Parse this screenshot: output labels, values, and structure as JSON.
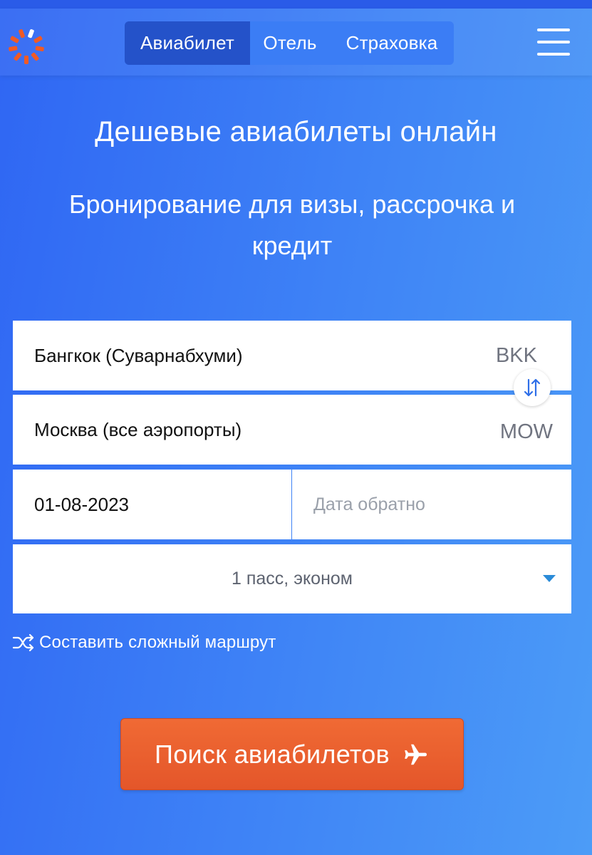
{
  "nav": {
    "tabs": [
      {
        "label": "Авиабилет",
        "active": true
      },
      {
        "label": "Отель",
        "active": false
      },
      {
        "label": "Страховка",
        "active": false
      }
    ],
    "logo_icon": "loading-ring-logo",
    "menu_icon": "hamburger-icon"
  },
  "hero": {
    "title": "Дешевые авиабилеты онлайн",
    "subtitle": "Бронирование для визы, рассрочка и кредит"
  },
  "form": {
    "from": {
      "city": "Бангкок (Суварнабхуми)",
      "code": "BKK"
    },
    "to": {
      "city": "Москва (все аэропорты)",
      "code": "MOW"
    },
    "depart_date": "01-08-2023",
    "return_placeholder": "Дата обратно",
    "passengers": "1 пасс, эконом",
    "complex_route": "Составить сложный маршрут"
  },
  "search_button": {
    "label": "Поиск авиабилетов",
    "icon": "airplane-icon"
  },
  "colors": {
    "background": "#3f84f6",
    "active_tab": "#2452c9",
    "button": "#e95e2e",
    "logo_orange": "#f15a24"
  }
}
